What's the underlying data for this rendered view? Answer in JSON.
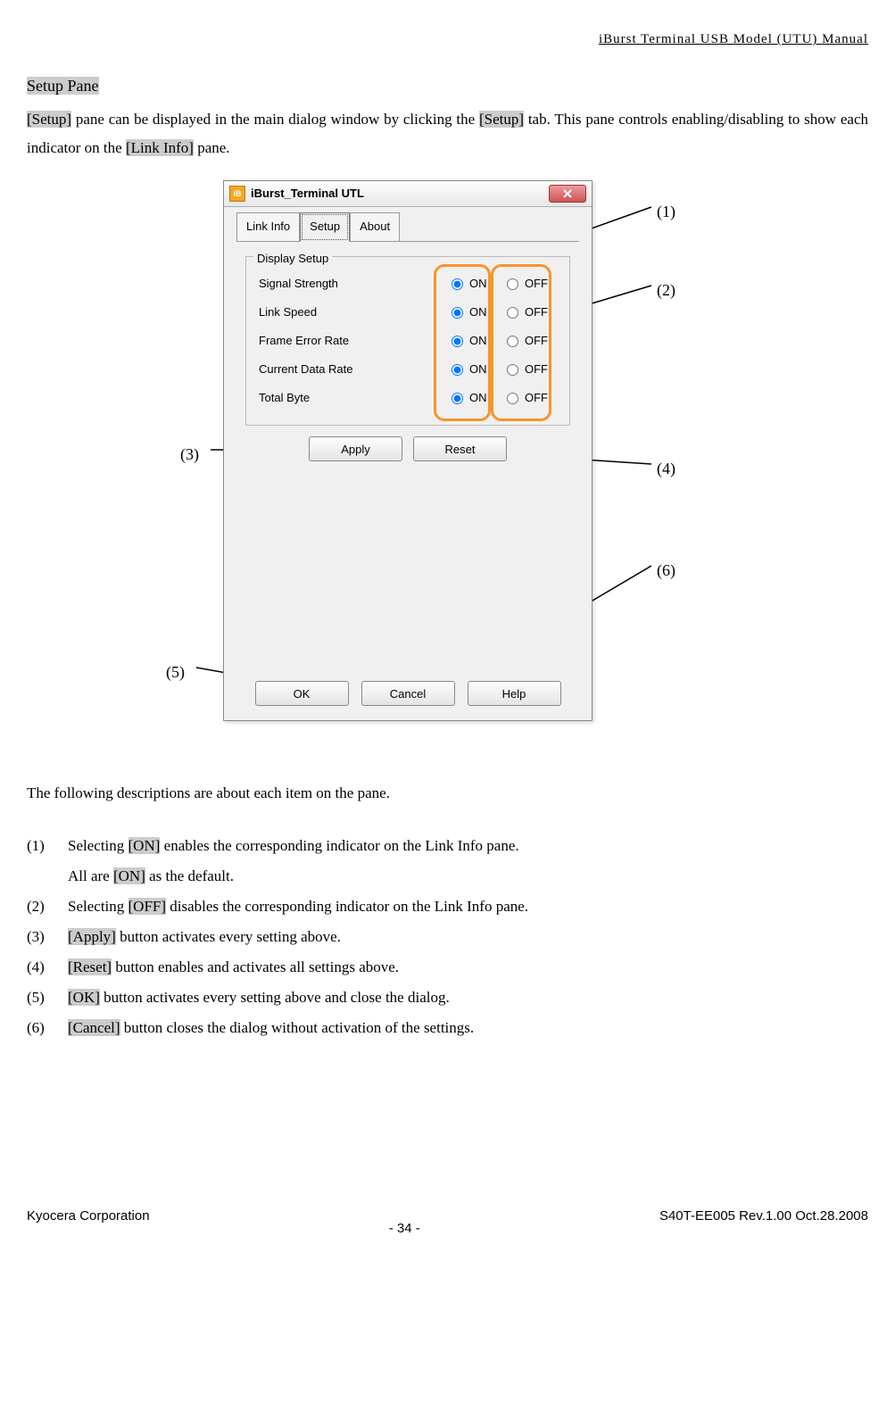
{
  "header": {
    "manual_title": "iBurst  Terminal  USB  Model  (UTU)  Manual"
  },
  "section": {
    "title": "Setup Pane",
    "intro_parts": {
      "t1": "[Setup]",
      "t2": " pane can be displayed in the main dialog window by clicking the ",
      "t3": "[Setup]",
      "t4": " tab.   This pane controls enabling/disabling to show each indicator on the ",
      "t5": "[Link Info]",
      "t6": " pane."
    }
  },
  "dialog": {
    "window_title": "iBurst_Terminal UTL",
    "icon_label": "iB",
    "tabs": {
      "link_info": "Link Info",
      "setup": "Setup",
      "about": "About"
    },
    "group_title": "Display Setup",
    "on_label": "ON",
    "off_label": "OFF",
    "rows": [
      {
        "label": "Signal Strength"
      },
      {
        "label": "Link Speed"
      },
      {
        "label": "Frame Error Rate"
      },
      {
        "label": "Current Data Rate"
      },
      {
        "label": "Total Byte"
      }
    ],
    "buttons": {
      "apply": "Apply",
      "reset": "Reset",
      "ok": "OK",
      "cancel": "Cancel",
      "help": "Help"
    }
  },
  "callouts": {
    "c1": "(1)",
    "c2": "(2)",
    "c3": "(3)",
    "c4": "(4)",
    "c5": "(5)",
    "c6": "(6)"
  },
  "descriptions": {
    "intro": "The following descriptions are about each item on the pane.",
    "items": [
      {
        "num": "(1)",
        "pre": "Selecting ",
        "hl": "[ON]",
        "post": " enables the corresponding indicator on the Link Info pane.",
        "sub_pre": "All are ",
        "sub_hl": "[ON]",
        "sub_post": " as the default."
      },
      {
        "num": "(2)",
        "pre": "Selecting ",
        "hl": "[OFF]",
        "post": " disables the corresponding indicator on the Link Info pane."
      },
      {
        "num": "(3)",
        "pre": "",
        "hl": "[Apply]",
        "post": " button activates every setting above."
      },
      {
        "num": "(4)",
        "pre": "",
        "hl": "[Reset]",
        "post": " button enables and activates all settings above."
      },
      {
        "num": "(5)",
        "pre": "",
        "hl": "[OK]",
        "post": " button activates every setting above and close the dialog."
      },
      {
        "num": "(6)",
        "pre": "",
        "hl": "[Cancel]",
        "post": " button closes the dialog without activation of the settings."
      }
    ]
  },
  "footer": {
    "company": "Kyocera Corporation",
    "page": "- 34 -",
    "docref": "S40T-EE005 Rev.1.00 Oct.28.2008"
  }
}
